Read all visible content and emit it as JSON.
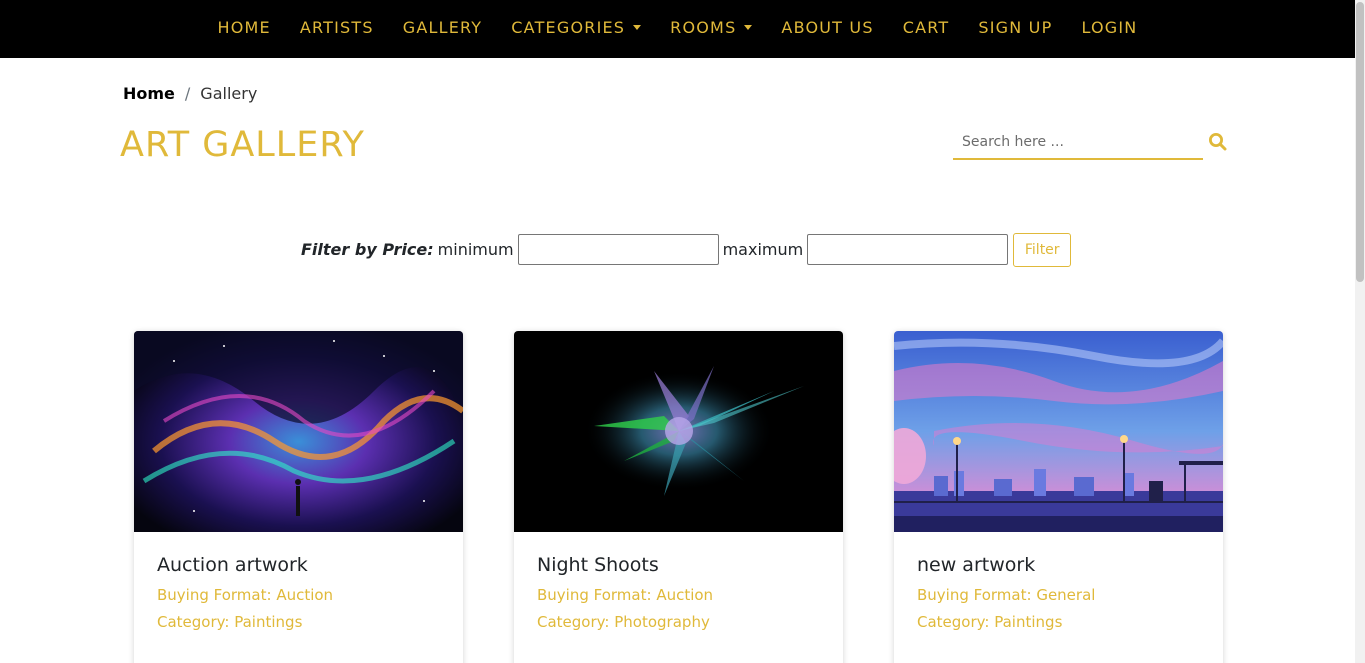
{
  "nav": {
    "items": [
      {
        "label": "HOME",
        "dropdown": false
      },
      {
        "label": "ARTISTS",
        "dropdown": false
      },
      {
        "label": "GALLERY",
        "dropdown": false
      },
      {
        "label": "CATEGORIES",
        "dropdown": true
      },
      {
        "label": "ROOMS",
        "dropdown": true
      },
      {
        "label": "ABOUT US",
        "dropdown": false
      },
      {
        "label": "CART",
        "dropdown": false
      },
      {
        "label": "SIGN UP",
        "dropdown": false
      },
      {
        "label": "LOGIN",
        "dropdown": false
      }
    ]
  },
  "breadcrumb": {
    "home": "Home",
    "separator": "/",
    "current": "Gallery"
  },
  "page": {
    "title": "ART GALLERY"
  },
  "search": {
    "placeholder": "Search here ...",
    "value": ""
  },
  "filter": {
    "label": "Filter by Price:",
    "min_label": "minimum",
    "max_label": "maximum",
    "min_value": "",
    "max_value": "",
    "button_label": "Filter"
  },
  "cards": [
    {
      "title": "Auction artwork",
      "format": "Buying Format: Auction",
      "category": "Category: Paintings",
      "image": "cosmic-space-painting"
    },
    {
      "title": "Night Shoots",
      "format": "Buying Format: Auction",
      "category": "Category: Photography",
      "image": "color-powder-explosion"
    },
    {
      "title": "new artwork",
      "format": "Buying Format: General",
      "category": "Category: Paintings",
      "image": "anime-city-sky"
    }
  ],
  "colors": {
    "accent": "#e0b93a",
    "navbar": "#000000"
  }
}
